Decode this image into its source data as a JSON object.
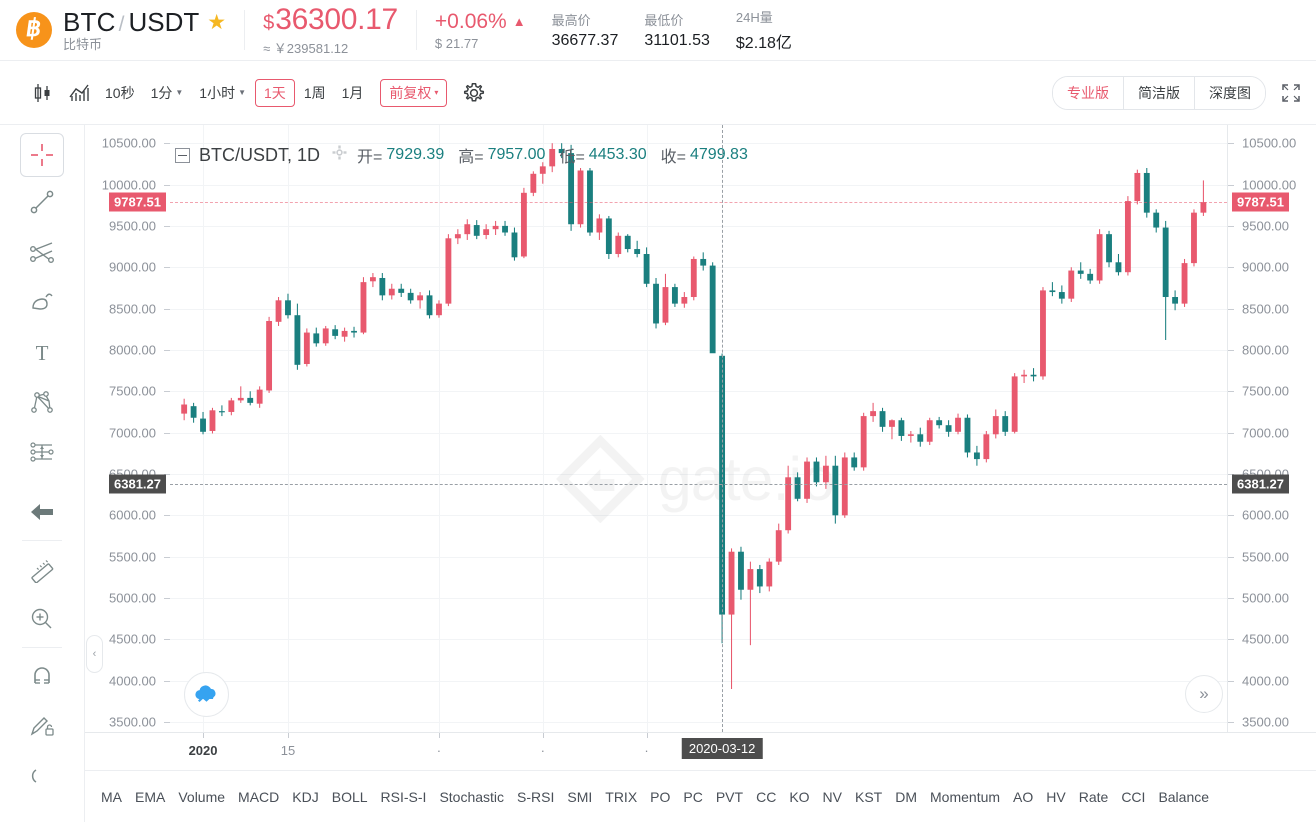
{
  "header": {
    "coin_symbol": "฿",
    "pair_base": "BTC",
    "pair_separator": "/",
    "pair_quote": "USDT",
    "pair_cn_name": "比特币",
    "favorite_icon": "★",
    "price_currency": "$",
    "price_value": "36300.17",
    "price_secondary": "≈ ￥239581.12",
    "change_pct": "+0.06%",
    "change_arrow": "▲",
    "change_abs": "$ 21.77",
    "stats": [
      {
        "label": "最高价",
        "value": "36677.37"
      },
      {
        "label": "最低价",
        "value": "31101.53"
      },
      {
        "label": "24H量",
        "value": "$2.18亿"
      }
    ]
  },
  "toolbar": {
    "candle_icon": "candlestick-icon",
    "indicator_icon": "indicator-chart-icon",
    "intervals": [
      {
        "label": "10秒",
        "caret": false,
        "active": false
      },
      {
        "label": "1分",
        "caret": true,
        "active": false
      },
      {
        "label": "1小时",
        "caret": true,
        "active": false
      },
      {
        "label": "1天",
        "caret": false,
        "active": true
      },
      {
        "label": "1周",
        "caret": false,
        "active": false
      },
      {
        "label": "1月",
        "caret": false,
        "active": false
      }
    ],
    "adjust_label": "前复权",
    "adjust_caret": "▾",
    "settings_icon": "gear-icon",
    "views": [
      {
        "label": "专业版",
        "active": true
      },
      {
        "label": "简洁版",
        "active": false
      },
      {
        "label": "深度图",
        "active": false
      }
    ],
    "fullscreen_icon": "fullscreen-icon"
  },
  "rail": {
    "tools": [
      {
        "name": "crosshair-tool",
        "selected": true
      },
      {
        "name": "trendline-tool",
        "selected": false
      },
      {
        "name": "pitchfork-tool",
        "selected": false
      },
      {
        "name": "shape-tool",
        "selected": false
      },
      {
        "name": "text-tool",
        "selected": false
      },
      {
        "name": "pattern-tool",
        "selected": false
      },
      {
        "name": "forecast-tool",
        "selected": false
      },
      {
        "name": "arrow-left-tool",
        "selected": false
      },
      {
        "name": "measure-tool",
        "selected": false
      },
      {
        "name": "zoom-in-tool",
        "selected": false
      },
      {
        "name": "magnet-tool",
        "selected": false
      },
      {
        "name": "lock-drawing-tool",
        "selected": false
      },
      {
        "name": "hide-drawings-tool",
        "selected": false
      }
    ]
  },
  "chart_legend": {
    "collapse_icon": "minus-box-icon",
    "title": "BTC/USDT, 1D",
    "gear_icon": "gear-icon",
    "fields": [
      {
        "label": "开=",
        "value": "7929.39"
      },
      {
        "label": "高=",
        "value": "7957.00"
      },
      {
        "label": "低=",
        "value": "4453.30"
      },
      {
        "label": "收=",
        "value": "4799.83"
      }
    ]
  },
  "watermark": {
    "text": "gate.io",
    "logo": "gate-diamond-logo"
  },
  "float_buttons": {
    "chart_cloud_icon": "cloud-chart-icon",
    "scroll_right_icon": "»",
    "collapse_tab_icon": "‹"
  },
  "indicators": [
    "MA",
    "EMA",
    "Volume",
    "MACD",
    "KDJ",
    "BOLL",
    "RSI-S-I",
    "Stochastic",
    "S-RSI",
    "SMI",
    "TRIX",
    "PO",
    "PC",
    "PVT",
    "CC",
    "KO",
    "NV",
    "KST",
    "DM",
    "Momentum",
    "AO",
    "HV",
    "Rate",
    "CCI",
    "Balance"
  ],
  "colors": {
    "up": "#e8596e",
    "down": "#1a7f7f",
    "accent": "#e8596e",
    "brand_orange": "#f7931a",
    "crosshair_badge": "#4d4d4d",
    "text_muted": "#8c9199"
  },
  "chart_data": {
    "type": "candlestick",
    "title": "BTC/USDT, 1D",
    "symbol": "BTC/USDT",
    "interval": "1D",
    "ylabel": "",
    "xlabel": "",
    "ylim": [
      3380,
      10720
    ],
    "y_ticks": [
      3500,
      4000,
      4500,
      5000,
      5500,
      6000,
      6500,
      7000,
      7500,
      8000,
      8500,
      9000,
      9500,
      10000,
      10500
    ],
    "y_tick_labels": [
      "3500.00",
      "4000.00",
      "4500.00",
      "5000.00",
      "5500.00",
      "6000.00",
      "6500.00",
      "7000.00",
      "7500.00",
      "8000.00",
      "8500.00",
      "9000.00",
      "9500.00",
      "10000.00",
      "10500.00"
    ],
    "last_price": 9787.51,
    "last_price_label": "9787.51",
    "crosshair_price": 6381.27,
    "crosshair_price_label": "6381.27",
    "crosshair_date_label": "2020-03-12",
    "crosshair_index": 57,
    "x_tick_labels": [
      {
        "label": "2020",
        "index": 2,
        "bold": true
      },
      {
        "label": "15",
        "index": 11,
        "bold": false
      },
      {
        "label": "·",
        "index": 27,
        "bold": false
      },
      {
        "label": "·",
        "index": 38,
        "bold": false
      },
      {
        "label": "·",
        "index": 49,
        "bold": false
      }
    ],
    "grid": true,
    "ohlc": [
      [
        7230,
        7410,
        7150,
        7340
      ],
      [
        7320,
        7360,
        7120,
        7180
      ],
      [
        7170,
        7250,
        6980,
        7010
      ],
      [
        7020,
        7300,
        6990,
        7270
      ],
      [
        7260,
        7330,
        7200,
        7250
      ],
      [
        7250,
        7420,
        7210,
        7390
      ],
      [
        7390,
        7560,
        7360,
        7420
      ],
      [
        7420,
        7500,
        7330,
        7360
      ],
      [
        7350,
        7560,
        7300,
        7520
      ],
      [
        7510,
        8400,
        7480,
        8350
      ],
      [
        8340,
        8640,
        8290,
        8600
      ],
      [
        8600,
        8680,
        8380,
        8420
      ],
      [
        8420,
        8560,
        7760,
        7820
      ],
      [
        7830,
        8260,
        7800,
        8210
      ],
      [
        8200,
        8270,
        8040,
        8080
      ],
      [
        8080,
        8290,
        8050,
        8260
      ],
      [
        8250,
        8300,
        8130,
        8170
      ],
      [
        8160,
        8270,
        8100,
        8230
      ],
      [
        8230,
        8280,
        8150,
        8210
      ],
      [
        8210,
        8880,
        8190,
        8820
      ],
      [
        8830,
        8930,
        8760,
        8880
      ],
      [
        8870,
        8930,
        8600,
        8660
      ],
      [
        8660,
        8800,
        8610,
        8740
      ],
      [
        8740,
        8800,
        8640,
        8690
      ],
      [
        8690,
        8740,
        8560,
        8600
      ],
      [
        8600,
        8700,
        8500,
        8660
      ],
      [
        8660,
        8720,
        8380,
        8420
      ],
      [
        8420,
        8600,
        8390,
        8560
      ],
      [
        8560,
        9400,
        8530,
        9350
      ],
      [
        9350,
        9460,
        9280,
        9400
      ],
      [
        9400,
        9580,
        9330,
        9520
      ],
      [
        9510,
        9570,
        9340,
        9380
      ],
      [
        9390,
        9520,
        9340,
        9460
      ],
      [
        9460,
        9560,
        9390,
        9500
      ],
      [
        9500,
        9560,
        9380,
        9420
      ],
      [
        9420,
        9480,
        9080,
        9120
      ],
      [
        9130,
        9960,
        9110,
        9900
      ],
      [
        9900,
        10160,
        9860,
        10130
      ],
      [
        10130,
        10270,
        10010,
        10220
      ],
      [
        10220,
        10500,
        10150,
        10430
      ],
      [
        10430,
        10500,
        10320,
        10380
      ],
      [
        10380,
        10480,
        9440,
        9520
      ],
      [
        9520,
        10200,
        9480,
        10170
      ],
      [
        10170,
        10200,
        9380,
        9420
      ],
      [
        9420,
        9640,
        9330,
        9590
      ],
      [
        9590,
        9620,
        9100,
        9160
      ],
      [
        9160,
        9420,
        9120,
        9380
      ],
      [
        9380,
        9400,
        9180,
        9220
      ],
      [
        9220,
        9320,
        9120,
        9160
      ],
      [
        9160,
        9240,
        8760,
        8800
      ],
      [
        8800,
        8870,
        8260,
        8320
      ],
      [
        8330,
        8920,
        8300,
        8760
      ],
      [
        8760,
        8800,
        8520,
        8560
      ],
      [
        8560,
        8700,
        8510,
        8640
      ],
      [
        8640,
        9130,
        8600,
        9100
      ],
      [
        9100,
        9180,
        8960,
        9020
      ],
      [
        9020,
        9060,
        8750,
        7960
      ],
      [
        7929,
        7957,
        4453,
        4800
      ],
      [
        4800,
        5600,
        3900,
        5560
      ],
      [
        5560,
        5620,
        4980,
        5100
      ],
      [
        5100,
        5440,
        4430,
        5350
      ],
      [
        5350,
        5400,
        5060,
        5140
      ],
      [
        5140,
        5480,
        5080,
        5440
      ],
      [
        5440,
        5900,
        5400,
        5820
      ],
      [
        5820,
        6600,
        5780,
        6460
      ],
      [
        6460,
        6520,
        6170,
        6200
      ],
      [
        6200,
        6700,
        6150,
        6650
      ],
      [
        6650,
        6700,
        6350,
        6400
      ],
      [
        6400,
        6720,
        6320,
        6600
      ],
      [
        6600,
        6720,
        5900,
        6000
      ],
      [
        6000,
        6760,
        5970,
        6700
      ],
      [
        6700,
        6760,
        6540,
        6580
      ],
      [
        6580,
        7240,
        6540,
        7200
      ],
      [
        7200,
        7360,
        7130,
        7260
      ],
      [
        7260,
        7300,
        7010,
        7070
      ],
      [
        7070,
        7160,
        6920,
        7150
      ],
      [
        7150,
        7180,
        6900,
        6960
      ],
      [
        6960,
        7020,
        6880,
        6980
      ],
      [
        6980,
        7060,
        6830,
        6890
      ],
      [
        6890,
        7180,
        6850,
        7150
      ],
      [
        7150,
        7190,
        7050,
        7090
      ],
      [
        7090,
        7150,
        6950,
        7010
      ],
      [
        7010,
        7230,
        6980,
        7180
      ],
      [
        7180,
        7220,
        6700,
        6760
      ],
      [
        6760,
        6840,
        6600,
        6680
      ],
      [
        6680,
        7020,
        6640,
        6980
      ],
      [
        6980,
        7280,
        6930,
        7200
      ],
      [
        7200,
        7260,
        6960,
        7010
      ],
      [
        7010,
        7720,
        6990,
        7680
      ],
      [
        7680,
        7760,
        7600,
        7700
      ],
      [
        7700,
        7780,
        7620,
        7680
      ],
      [
        7680,
        8760,
        7640,
        8720
      ],
      [
        8720,
        8820,
        8650,
        8700
      ],
      [
        8700,
        8780,
        8560,
        8620
      ],
      [
        8620,
        9000,
        8580,
        8960
      ],
      [
        8960,
        9060,
        8860,
        8920
      ],
      [
        8920,
        8980,
        8800,
        8840
      ],
      [
        8840,
        9460,
        8800,
        9400
      ],
      [
        9400,
        9440,
        9000,
        9060
      ],
      [
        9060,
        9160,
        8900,
        8940
      ],
      [
        8940,
        9860,
        8900,
        9800
      ],
      [
        9800,
        10180,
        9760,
        10140
      ],
      [
        10140,
        10200,
        9600,
        9660
      ],
      [
        9660,
        9700,
        9420,
        9480
      ],
      [
        9480,
        9560,
        8120,
        8640
      ],
      [
        8640,
        8720,
        8480,
        8560
      ],
      [
        8560,
        9100,
        8520,
        9050
      ],
      [
        9050,
        9700,
        9010,
        9660
      ],
      [
        9660,
        10050,
        9620,
        9787
      ]
    ]
  }
}
